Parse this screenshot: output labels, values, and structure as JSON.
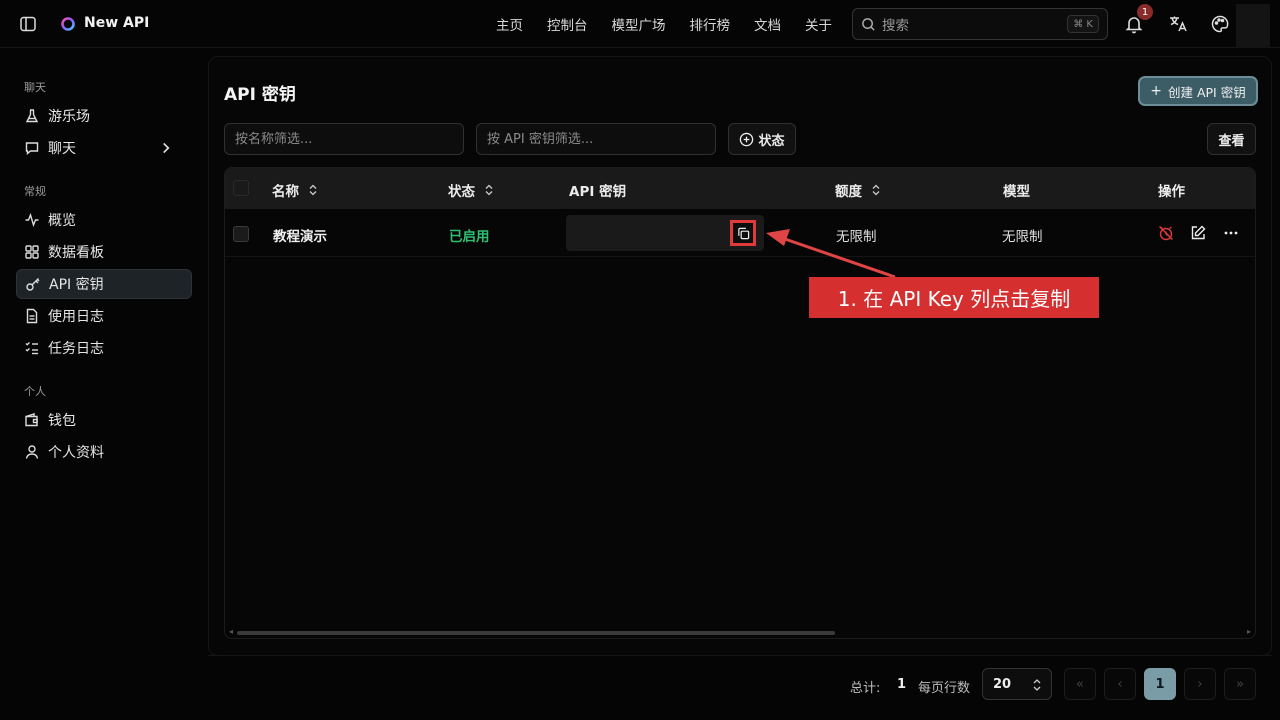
{
  "header": {
    "brand": "New API",
    "nav": [
      "主页",
      "控制台",
      "模型广场",
      "排行榜",
      "文档",
      "关于"
    ],
    "search_placeholder": "搜索",
    "search_shortcut": "⌘ K",
    "notification_count": "1"
  },
  "sidebar": {
    "sections": [
      {
        "label": "聊天",
        "items": [
          {
            "label": "游乐场",
            "icon": "flask-icon"
          },
          {
            "label": "聊天",
            "icon": "chat-icon"
          }
        ]
      },
      {
        "label": "常规",
        "items": [
          {
            "label": "概览",
            "icon": "activity-icon"
          },
          {
            "label": "数据看板",
            "icon": "dashboard-icon"
          },
          {
            "label": "API 密钥",
            "icon": "key-icon"
          },
          {
            "label": "使用日志",
            "icon": "log-icon"
          },
          {
            "label": "任务日志",
            "icon": "tasks-icon"
          }
        ]
      },
      {
        "label": "个人",
        "items": [
          {
            "label": "钱包",
            "icon": "wallet-icon"
          },
          {
            "label": "个人资料",
            "icon": "user-icon"
          }
        ]
      }
    ],
    "active": "API 密钥"
  },
  "page": {
    "title": "API 密钥",
    "create_button": "创建 API 密钥",
    "filter_name_placeholder": "按名称筛选...",
    "filter_key_placeholder": "按 API 密钥筛选...",
    "status_button": "状态",
    "view_button": "查看"
  },
  "table": {
    "columns": [
      "名称",
      "状态",
      "API 密钥",
      "额度",
      "模型",
      "操作"
    ],
    "rows": [
      {
        "name": "教程演示",
        "status": "已启用",
        "key": "",
        "quota": "无限制",
        "models": "无限制"
      }
    ]
  },
  "annotation": {
    "text": "1. 在 API Key 列点击复制",
    "color": "#d62f2f"
  },
  "pagination": {
    "total_label": "总计:",
    "total": "1",
    "per_page_label": "每页行数",
    "per_page": "20",
    "current_page": "1"
  },
  "colors": {
    "accent": "#7a9ca6",
    "status_enabled": "#2fbf71",
    "danger": "#e03a3a"
  }
}
